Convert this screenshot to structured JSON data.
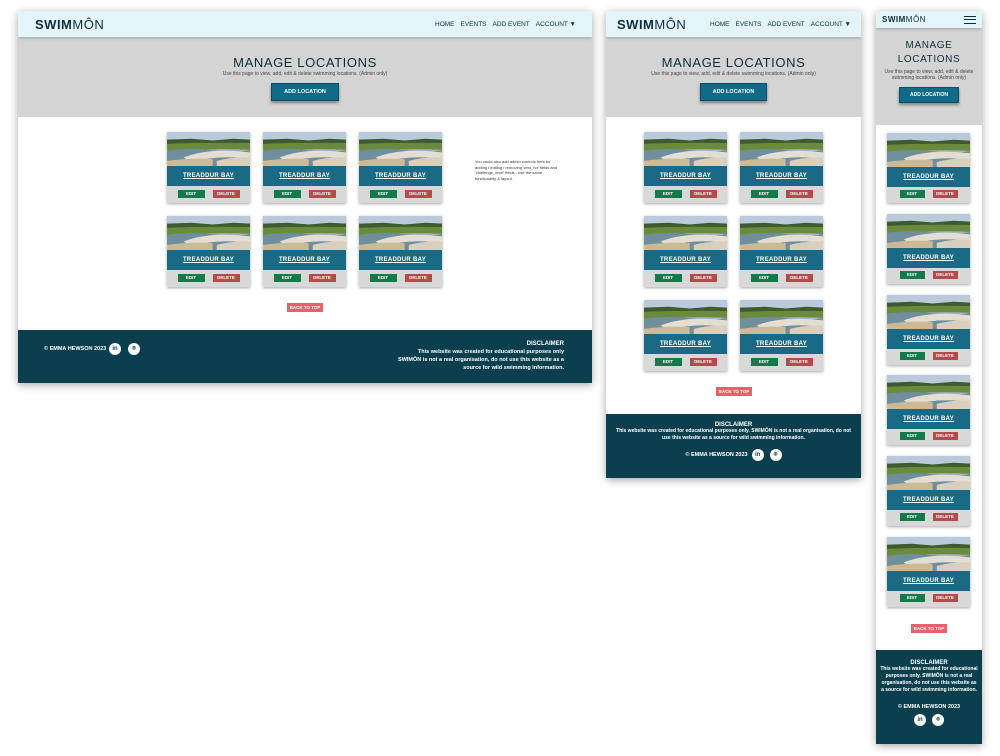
{
  "brand": {
    "bold": "SWIM",
    "light": "MÔN"
  },
  "nav": {
    "home": "HOME",
    "events": "EVENTS",
    "add_event": "ADD EVENT",
    "account": "ACCOUNT ▼"
  },
  "hero": {
    "title": "MANAGE LOCATIONS",
    "subtitle": "Use this page to view, add, edit & delete swimming locations. (Admin only)",
    "add_button": "ADD LOCATION"
  },
  "cards": [
    {
      "title": "TREADDUR BAY",
      "edit": "EDIT",
      "delete": "DELETE"
    },
    {
      "title": "TREADDUR BAY",
      "edit": "EDIT",
      "delete": "DELETE"
    },
    {
      "title": "TREADDUR BAY",
      "edit": "EDIT",
      "delete": "DELETE"
    },
    {
      "title": "TREADDUR BAY",
      "edit": "EDIT",
      "delete": "DELETE"
    },
    {
      "title": "TREADDUR BAY",
      "edit": "EDIT",
      "delete": "DELETE"
    },
    {
      "title": "TREADDUR BAY",
      "edit": "EDIT",
      "delete": "DELETE"
    }
  ],
  "note": "You could also add admin controls here for adding / editing / removing 'who_for' fields and 'challenge_level' fields - use the same functionality & layout.",
  "back_to_top": "BACK TO TOP",
  "footer": {
    "copyright": "© EMMA HEWSON 2023",
    "disclaimer_title": "DISCLAIMER",
    "disclaimer_body": "This website was created for educational purposes only. SWIMÔN is not a real organisation, do not use this website as a source for wild swimming information.",
    "desktop_disclaimer_lines": [
      "This website was created for educational purposes only",
      "SWIMÔN is not a real organisation, do not use this website as a",
      "source for wild swimming information."
    ],
    "linkedin_icon": "linkedin-icon",
    "github_icon": "github-icon"
  },
  "colors": {
    "navbar": "#e3f4fa",
    "hero": "#d4d4d4",
    "primary": "#0f6b88",
    "card_title": "#1b6a85",
    "edit": "#137a4a",
    "delete": "#b44b4b",
    "back_to_top": "#e9606a",
    "footer": "#0b3f4e"
  }
}
